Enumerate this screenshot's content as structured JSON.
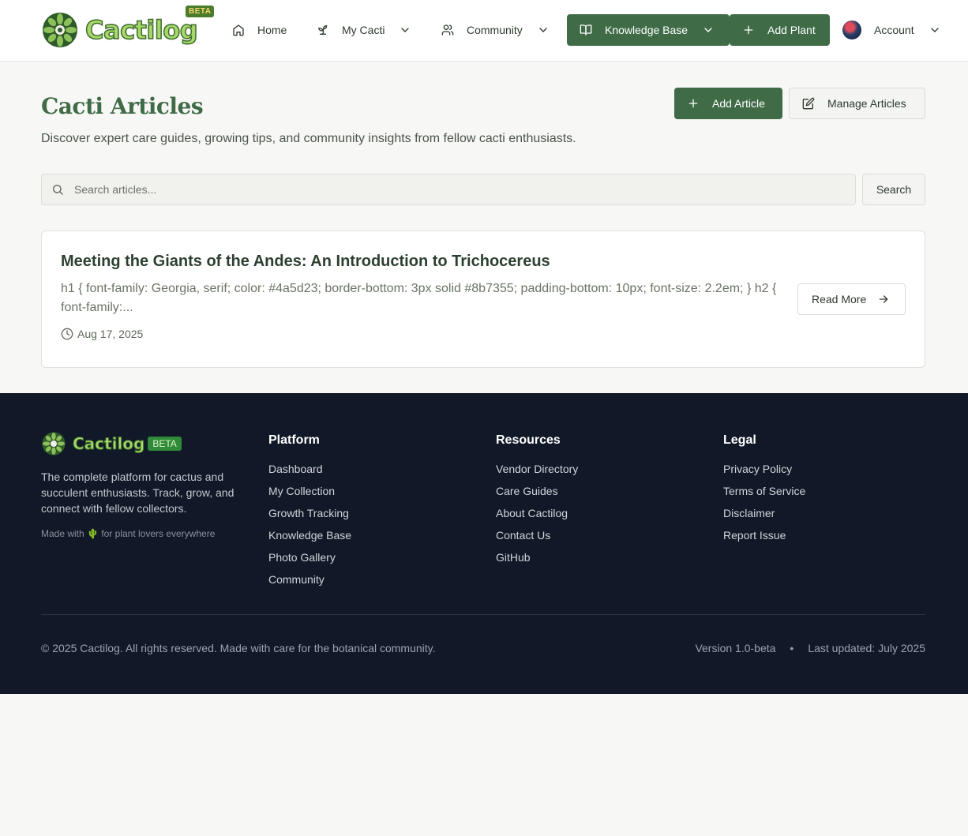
{
  "header": {
    "logo_text": "Cactilog",
    "beta_label": "BETA",
    "nav": {
      "home": "Home",
      "my_cacti": "My Cacti",
      "community": "Community",
      "knowledge_base": "Knowledge Base",
      "add_plant": "Add Plant",
      "account": "Account"
    }
  },
  "main": {
    "title": "Cacti Articles",
    "description": "Discover expert care guides, growing tips, and community insights from fellow cacti enthusiasts.",
    "add_article_label": "Add Article",
    "manage_articles_label": "Manage Articles",
    "search": {
      "placeholder": "Search articles...",
      "value": "",
      "button_label": "Search"
    },
    "articles": [
      {
        "title": "Meeting the Giants of the Andes: An Introduction to Trichocereus",
        "excerpt": "h1 { font-family: Georgia, serif; color: #4a5d23; border-bottom: 3px solid #8b7355; padding-bottom: 10px; font-size: 2.2em; } h2 { font-family:...",
        "date": "Aug 17, 2025",
        "read_more_label": "Read More"
      }
    ]
  },
  "footer": {
    "logo_text": "Cactilog",
    "beta_label": "BETA",
    "description": "The complete platform for cactus and succulent enthusiasts. Track, grow, and connect with fellow collectors.",
    "made_with": "Made with 🌵 for plant lovers everywhere",
    "platform": {
      "heading": "Platform",
      "links": [
        "Dashboard",
        "My Collection",
        "Growth Tracking",
        "Knowledge Base",
        "Photo Gallery",
        "Community"
      ]
    },
    "resources": {
      "heading": "Resources",
      "links": [
        "Vendor Directory",
        "Care Guides",
        "About Cactilog",
        "Contact Us",
        "GitHub"
      ]
    },
    "legal": {
      "heading": "Legal",
      "links": [
        "Privacy Policy",
        "Terms of Service",
        "Disclaimer",
        "Report Issue"
      ]
    },
    "copyright": "© 2025 Cactilog. All rights reserved. Made with care for the botanical community.",
    "version": "Version 1.0-beta",
    "separator": "•",
    "last_updated": "Last updated: July 2025"
  },
  "colors": {
    "brand_green": "#3f6b47",
    "footer_bg": "#111827",
    "logo_fill": "#a6d96a"
  },
  "icons": [
    "cactus-logo-icon",
    "home-icon",
    "sprout-icon",
    "users-icon",
    "book-open-icon",
    "plus-icon",
    "chevron-down-icon",
    "edit-icon",
    "search-icon",
    "clock-icon",
    "arrow-right-icon"
  ]
}
